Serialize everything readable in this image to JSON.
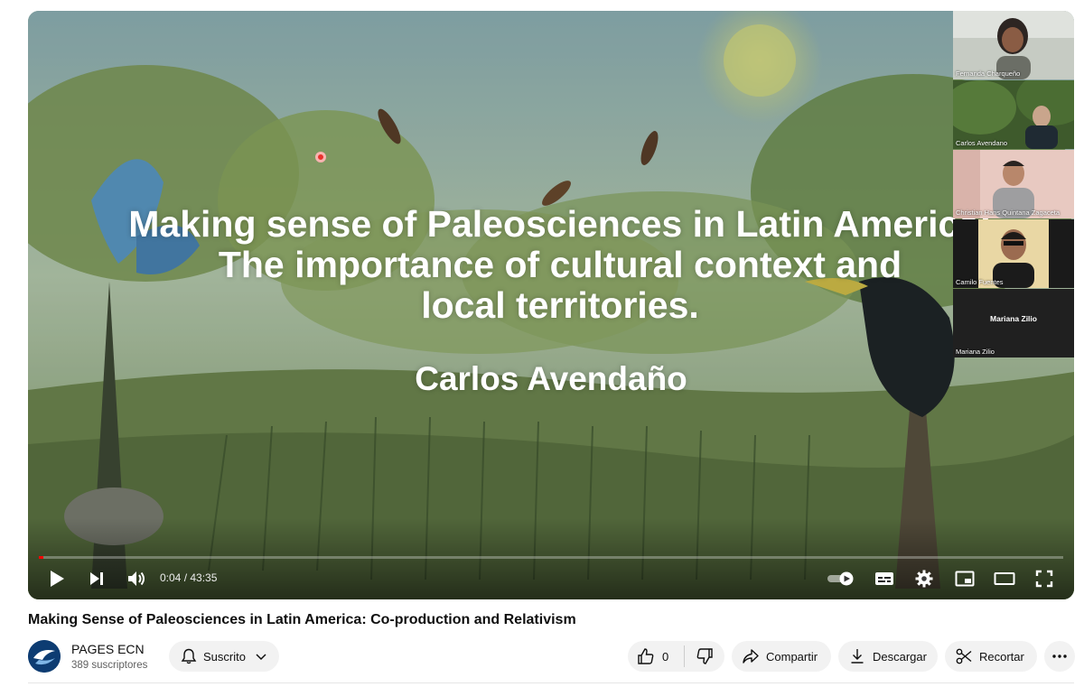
{
  "slide": {
    "title_line1": "Making sense of Paleosciences in Latin America:",
    "title_line2": "The importance of cultural context and",
    "title_line3": "local territories.",
    "author": "Carlos Avendaño"
  },
  "participants": [
    {
      "name": "Fernanda Charqueño"
    },
    {
      "name": "Carlos Avendano"
    },
    {
      "name": "Christian Hans Quintana Zagaceta"
    },
    {
      "name": "Camilo Fuentes"
    },
    {
      "name": "Mariana Zilio",
      "center_label": "Mariana Zilio"
    }
  ],
  "player": {
    "current_time": "0:04",
    "duration": "43:35",
    "time_display": "0:04 / 43:35",
    "progress_fraction": 0.0015,
    "progress_color": "#ff0000",
    "icons": [
      "play-icon",
      "next-icon",
      "volume-icon",
      "autoplay-toggle-icon",
      "subtitles-icon",
      "settings-icon",
      "miniplayer-icon",
      "theater-icon",
      "fullscreen-icon"
    ]
  },
  "video": {
    "title": "Making Sense of Paleosciences in Latin America: Co-production and Relativism"
  },
  "channel": {
    "name": "PAGES ECN",
    "subscribers": "389 suscriptores",
    "subscribe_label": "Suscrito"
  },
  "actions": {
    "like_count": "0",
    "share_label": "Compartir",
    "download_label": "Descargar",
    "clip_label": "Recortar"
  }
}
